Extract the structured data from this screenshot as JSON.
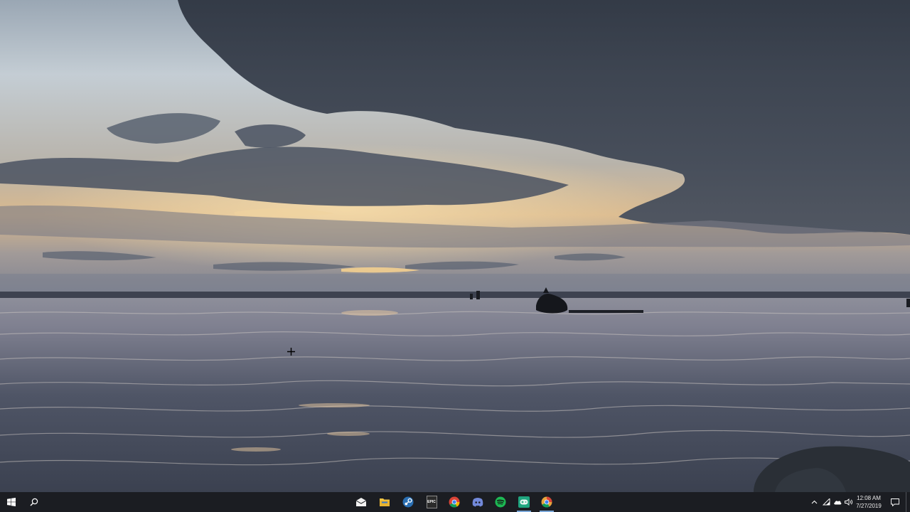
{
  "desktop": {
    "wallpaper": "cloudy-sunset-over-sea",
    "cursor": "crosshair-cursor"
  },
  "taskbar": {
    "start_icon": "windows-logo-icon",
    "search_icon": "search-icon",
    "pinned_apps": [
      {
        "name": "mail",
        "icon": "mail-icon",
        "color": "#f2f2f2"
      },
      {
        "name": "file-explorer",
        "icon": "folder-icon",
        "color": "#f4c542"
      },
      {
        "name": "steam",
        "icon": "steam-icon",
        "color": "#5b9bd5"
      },
      {
        "name": "epic-games",
        "icon": "epic-games-icon",
        "color": "#2b2b2b"
      },
      {
        "name": "chrome",
        "icon": "chrome-icon",
        "color": "#db4437"
      },
      {
        "name": "discord",
        "icon": "discord-icon",
        "color": "#7289da"
      },
      {
        "name": "spotify",
        "icon": "spotify-icon",
        "color": "#1db954"
      },
      {
        "name": "gamepad-app",
        "icon": "gamepad-icon",
        "color": "#1fa57f"
      },
      {
        "name": "chrome-canary",
        "icon": "chrome-canary-icon",
        "color": "#e8a33d"
      }
    ],
    "epic_label": "EPIC",
    "tray": {
      "icons": [
        "chevron-up-icon",
        "network-icon",
        "cloud-icon",
        "volume-icon"
      ]
    },
    "clock": {
      "time": "12:08 AM",
      "date": "7/27/2019"
    },
    "notification_icon": "notification-icon",
    "colors": {
      "taskbar_bg": "#1b1d22",
      "active_underline": "#7aa7d8"
    }
  }
}
